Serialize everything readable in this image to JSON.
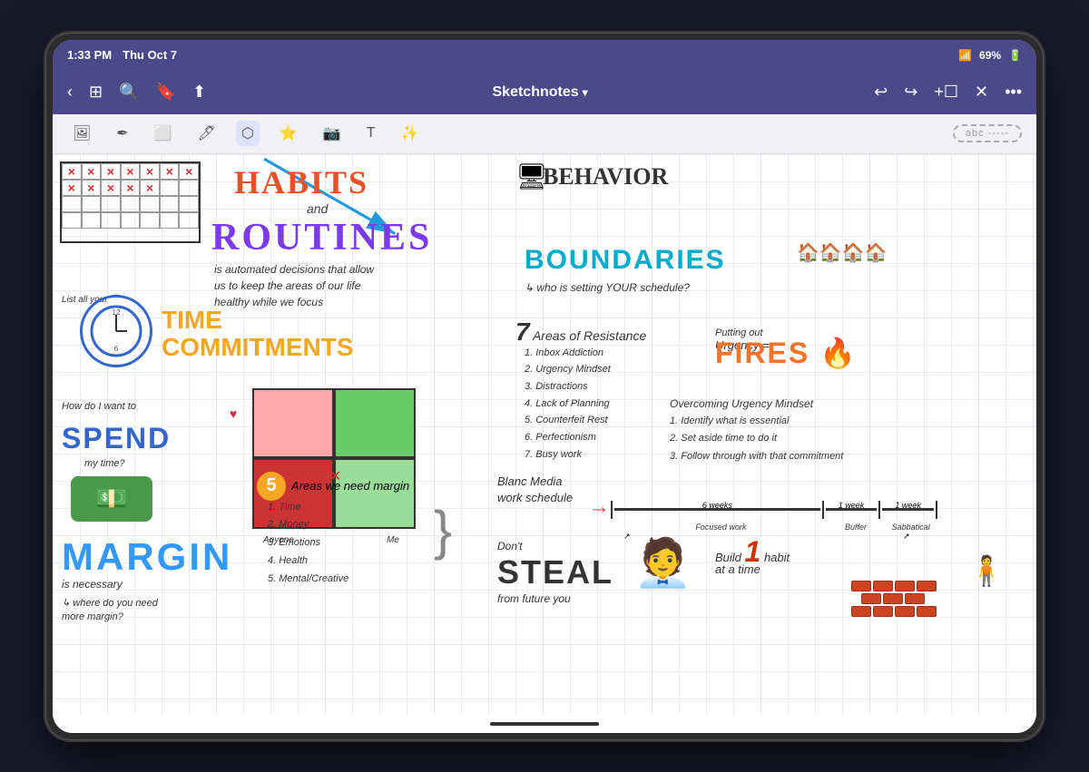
{
  "device": {
    "status_bar": {
      "time": "1:33 PM",
      "date": "Thu Oct 7",
      "wifi": "69%",
      "battery": "69%"
    },
    "nav_bar": {
      "title": "Sketchnotes",
      "title_icon": "▾",
      "more_dots": "•••"
    },
    "toolbar": {
      "tools": [
        "image",
        "pen",
        "eraser",
        "marker",
        "lasso",
        "shape",
        "photo",
        "text",
        "highlight"
      ],
      "lasso_label": "abc -----"
    }
  },
  "content": {
    "habits_title": "HABITS",
    "and_text": "and",
    "routines_title": "ROUTINES",
    "routines_desc": "is automated decisions that allow us to keep the areas of our life healthy while we focus",
    "behavior_title": "BEHAVIOR",
    "boundaries_title": "BOUNDARIES",
    "boundaries_sub": "↳ who is setting YOUR schedule?",
    "time_commitments": {
      "list_prompt": "List all your",
      "title_line1": "TIME",
      "title_line2": "COMMITMENTS"
    },
    "seven_areas": {
      "number": "7",
      "label": "Areas of Resistance",
      "items": [
        "1. Inbox Addiction",
        "2. Urgency Mindset",
        "3. Distractions",
        "4. Lack of Planning",
        "5. Counterfeit Rest",
        "6. Perfectionism",
        "7. Busy work"
      ]
    },
    "urgency": {
      "label": "Urgency =",
      "putting_out": "Putting out",
      "fires_title": "FIRES"
    },
    "spend": {
      "question": "How do I want to",
      "title": "SPEND",
      "sub": "my time?"
    },
    "overcoming": {
      "title": "Overcoming Urgency Mindset",
      "items": [
        "1. Identify what is essential",
        "2. Set aside time to do it",
        "3. Follow through with that commitment"
      ]
    },
    "five_areas": {
      "number": "5",
      "label": "Areas we need margin",
      "items": [
        "1. Time",
        "2. Money",
        "3. Emotions",
        "4. Health",
        "5. Mental/Creative"
      ]
    },
    "blanc_schedule": {
      "title": "Blanc Media\nwork schedule",
      "labels": {
        "six_weeks": "6 weeks",
        "one_week1": "1 week",
        "one_week2": "1 week"
      },
      "sub_labels": {
        "focused": "Focused work",
        "buffer": "Buffer",
        "sabbatical": "Sabbatical"
      }
    },
    "margin": {
      "title": "MARGIN",
      "sub": "is necessary",
      "question": "↳ where do you need\nmore margin?"
    },
    "steal": {
      "pre": "Don't",
      "title": "STEAL",
      "sub": "from future you"
    },
    "build": {
      "pre": "Build",
      "number": "1",
      "label": "habit",
      "post": "at a time"
    }
  }
}
